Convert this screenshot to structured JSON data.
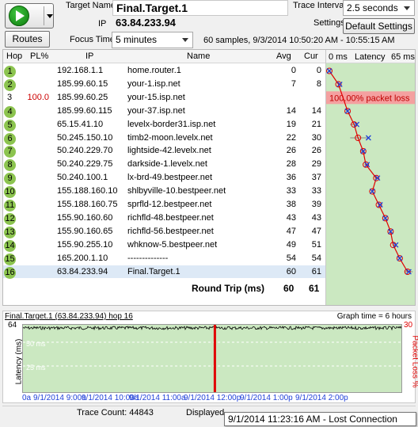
{
  "toolbar": {
    "routes_label": "Routes",
    "target_name_label": "Target Name",
    "target_name": "Final.Target.1",
    "ip_label": "IP",
    "ip_value": "63.84.233.94",
    "focus_time_label": "Focus Time",
    "focus_time_value": "5 minutes",
    "trace_interval_label": "Trace Interval",
    "trace_interval_value": "2.5 seconds",
    "settings_label": "Settings",
    "default_settings_label": "Default Settings",
    "samples_info": "60 samples, 9/3/2014 10:50:20 AM - 10:55:15 AM"
  },
  "table": {
    "headers": {
      "hop": "Hop",
      "pl": "PL%",
      "ip": "IP",
      "name": "Name",
      "avg": "Avg",
      "cur": "Cur"
    },
    "latency_header": {
      "min": "0 ms",
      "title": "Latency",
      "max": "65 ms"
    },
    "rows": [
      {
        "hop": "1",
        "pl": "",
        "ip": "192.168.1.1",
        "name": "home.router.1",
        "avg": "0",
        "cur": "0",
        "avg_ms": 0,
        "cur_ms": 0,
        "min_ms": 0,
        "max_ms": 0
      },
      {
        "hop": "2",
        "pl": "",
        "ip": "185.99.60.15",
        "name": "your-1.isp.net",
        "avg": "7",
        "cur": "8",
        "avg_ms": 7,
        "cur_ms": 8,
        "min_ms": 7,
        "max_ms": 8
      },
      {
        "hop": "3",
        "pl": "100.0",
        "ip": "185.99.60.25",
        "name": "your-15.isp.net",
        "avg": "",
        "cur": "",
        "loss_text": "100.00% packet loss"
      },
      {
        "hop": "4",
        "pl": "",
        "ip": "185.99.60.115",
        "name": "your-37.isp.net",
        "avg": "14",
        "cur": "14",
        "avg_ms": 14,
        "cur_ms": 14,
        "min_ms": 14,
        "max_ms": 14
      },
      {
        "hop": "5",
        "pl": "",
        "ip": "65.15.41.10",
        "name": "levelx-border31.isp.net",
        "avg": "19",
        "cur": "21",
        "avg_ms": 19,
        "cur_ms": 21,
        "min_ms": 16,
        "max_ms": 21
      },
      {
        "hop": "6",
        "pl": "",
        "ip": "50.245.150.10",
        "name": "timb2-moon.levelx.net",
        "avg": "22",
        "cur": "30",
        "avg_ms": 22,
        "cur_ms": 30,
        "min_ms": 16,
        "max_ms": 30
      },
      {
        "hop": "7",
        "pl": "",
        "ip": "50.240.229.70",
        "name": "lightside-42.levelx.net",
        "avg": "26",
        "cur": "26",
        "avg_ms": 26,
        "cur_ms": 26,
        "min_ms": 24,
        "max_ms": 27
      },
      {
        "hop": "8",
        "pl": "",
        "ip": "50.240.229.75",
        "name": "darkside-1.levelx.net",
        "avg": "28",
        "cur": "29",
        "avg_ms": 28,
        "cur_ms": 29,
        "min_ms": 27,
        "max_ms": 29
      },
      {
        "hop": "9",
        "pl": "",
        "ip": "50.240.100.1",
        "name": "lx-brd-49.bestpeer.net",
        "avg": "36",
        "cur": "37",
        "avg_ms": 36,
        "cur_ms": 37,
        "min_ms": 35,
        "max_ms": 37
      },
      {
        "hop": "10",
        "pl": "",
        "ip": "155.188.160.10",
        "name": "shlbyville-10.bestpeer.net",
        "avg": "33",
        "cur": "33",
        "avg_ms": 33,
        "cur_ms": 33,
        "min_ms": 33,
        "max_ms": 33
      },
      {
        "hop": "11",
        "pl": "",
        "ip": "155.188.160.75",
        "name": "sprfld-12.bestpeer.net",
        "avg": "38",
        "cur": "39",
        "avg_ms": 38,
        "cur_ms": 39,
        "min_ms": 38,
        "max_ms": 39
      },
      {
        "hop": "12",
        "pl": "",
        "ip": "155.90.160.60",
        "name": "richfld-48.bestpeer.net",
        "avg": "43",
        "cur": "43",
        "avg_ms": 43,
        "cur_ms": 43,
        "min_ms": 43,
        "max_ms": 43
      },
      {
        "hop": "13",
        "pl": "",
        "ip": "155.90.160.65",
        "name": "richfld-56.bestpeer.net",
        "avg": "47",
        "cur": "47",
        "avg_ms": 47,
        "cur_ms": 47,
        "min_ms": 47,
        "max_ms": 47
      },
      {
        "hop": "14",
        "pl": "",
        "ip": "155.90.255.10",
        "name": "whknow-5.bestpeer.net",
        "avg": "49",
        "cur": "51",
        "avg_ms": 49,
        "cur_ms": 51,
        "min_ms": 49,
        "max_ms": 51
      },
      {
        "hop": "15",
        "pl": "",
        "ip": "165.200.1.10",
        "name": "--------------",
        "avg": "54",
        "cur": "54",
        "avg_ms": 54,
        "cur_ms": 54,
        "min_ms": 54,
        "max_ms": 54
      },
      {
        "hop": "16",
        "pl": "",
        "ip": "63.84.233.94",
        "name": "Final.Target.1",
        "avg": "60",
        "cur": "61",
        "avg_ms": 60,
        "cur_ms": 61,
        "min_ms": 58,
        "max_ms": 64
      }
    ],
    "round_trip": {
      "label": "Round Trip (ms)",
      "avg": "60",
      "cur": "61"
    }
  },
  "graph": {
    "title": "Final.Target.1 (63.84.233.94) hop 16",
    "graph_time": "Graph time = 6 hours",
    "y_left_label": "Latency (ms)",
    "y_right_label": "Packet Loss %",
    "y_left_max": "64",
    "y_right_max": "30",
    "gridline_labels": [
      "50 ms",
      "25 ms"
    ],
    "x_labels": [
      "0a",
      "9/1/2014 9:00a",
      "9/1/2014 10:00a",
      "9/1/2014 11:00a",
      "9/1/2014 12:00p",
      "9/1/2014 1:00p",
      "9/1/2014 2:00p"
    ],
    "lost_connection_fraction": 0.505
  },
  "status": {
    "trace_count": "Trace Count: 44843",
    "displayed": "Displayed"
  },
  "tooltip": {
    "text": "9/1/2014 11:23:16 AM - Lost Connection"
  },
  "colors": {
    "hop_ok": "#8cc44f",
    "latency_bg": "#cbe8c1",
    "loss_red": "#e00000",
    "accent_blue": "#1f3fd8"
  }
}
